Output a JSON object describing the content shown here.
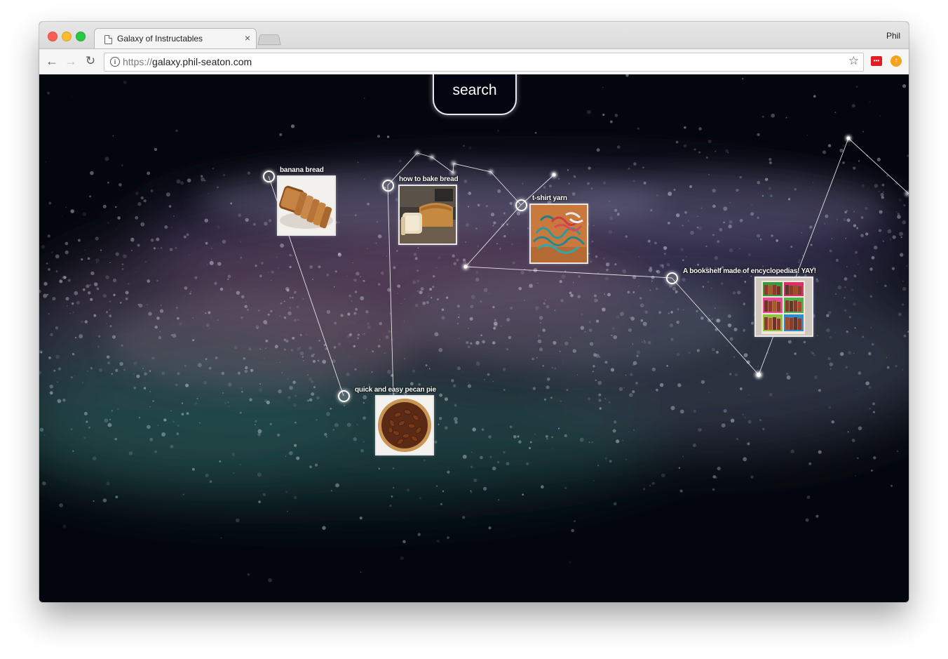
{
  "browser": {
    "tab_title": "Galaxy of Instructables",
    "tab_close": "×",
    "profile_name": "Phil",
    "url_scheme": "https://",
    "url_host": "galaxy.phil-seaton.com",
    "back_icon": "arrow-left-icon",
    "forward_icon": "arrow-right-icon",
    "reload_icon": "reload-icon",
    "bookmark_icon": "star-icon",
    "extensions": [
      "lastpass-icon",
      "upload-icon"
    ]
  },
  "page": {
    "search_label": "search",
    "background_color": "#03060c",
    "projects": [
      {
        "title": "banana bread",
        "image": "banana-bread-thumbnail"
      },
      {
        "title": "how to bake bread",
        "image": "bread-loaf-thumbnail"
      },
      {
        "title": "t-shirt yarn",
        "image": "tshirt-yarn-thumbnail"
      },
      {
        "title": "A bookshelf made of encyclopedias! YAY!",
        "image": "bookshelf-thumbnail"
      },
      {
        "title": "quick and easy pecan pie",
        "image": "pecan-pie-thumbnail"
      }
    ]
  }
}
